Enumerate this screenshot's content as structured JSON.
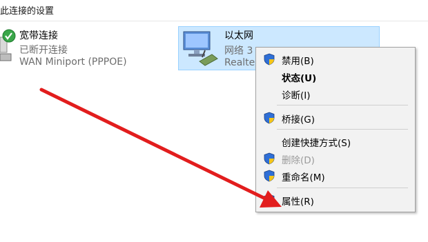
{
  "header": {
    "title": "此连接的设置"
  },
  "connections": [
    {
      "name": "宽带连接",
      "status": "已断开连接",
      "device": "WAN Miniport (PPPOE)"
    },
    {
      "name": "以太网",
      "status": "网络 3",
      "device": "Realte"
    }
  ],
  "menu": {
    "items": [
      {
        "label": "禁用(B)",
        "shield": true
      },
      {
        "label": "状态(U)",
        "bold": true
      },
      {
        "label": "诊断(I)"
      },
      {
        "label": "桥接(G)",
        "shield": true
      },
      {
        "label": "创建快捷方式(S)"
      },
      {
        "label": "删除(D)",
        "shield": true,
        "disabled": true
      },
      {
        "label": "重命名(M)",
        "shield": true
      },
      {
        "label": "属性(R)",
        "shield": true
      }
    ]
  },
  "colors": {
    "selection": "#cce8ff",
    "arrow": "#e21d1d",
    "shield_blue": "#2f6fd6",
    "shield_yellow": "#f5c518"
  }
}
